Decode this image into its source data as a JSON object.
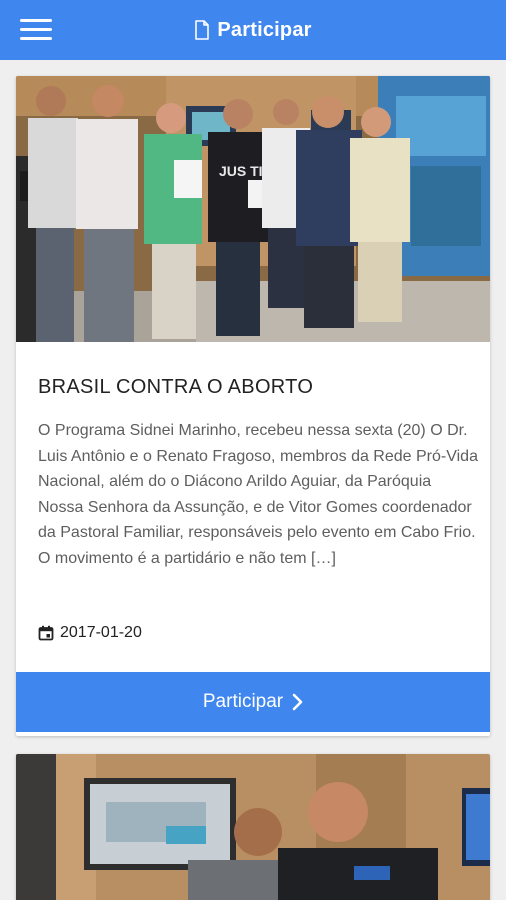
{
  "appbar": {
    "title": "Participar",
    "menu_icon": "hamburger-menu-icon",
    "title_icon": "document-icon",
    "color": "#3f86ef"
  },
  "posts": [
    {
      "title": "BRASIL CONTRA O ABORTO",
      "excerpt": "O Programa Sidnei Marinho, recebeu nessa sexta (20) O Dr. Luis Antônio e o Renato Fragoso, membros da Rede Pró-Vida Nacional, além do o Diácono Arildo Aguiar, da Paróquia Nossa Senhora da Assunção, e de Vitor Gomes coordenador da Pastoral Familiar, responsáveis pelo evento em Cabo Frio. O movimento  é a partidário e não tem […]",
      "date": "2017-01-20",
      "date_icon": "calendar-icon",
      "button_label": "Participar",
      "button_icon": "chevron-right-icon",
      "photo_caption": "",
      "photo_shirt_text": "JUS TIÇA"
    },
    {
      "title": "",
      "photo": "tv-studio-photo"
    }
  ]
}
